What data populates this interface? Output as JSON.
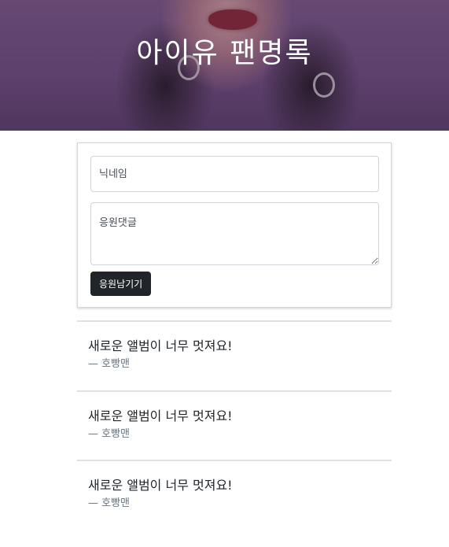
{
  "header": {
    "title": "아이유 팬명록"
  },
  "form": {
    "nickname_placeholder": "닉네임",
    "comment_placeholder": "응원댓글",
    "submit_label": "응원남기기"
  },
  "comments": [
    {
      "text": "새로운 앨범이 너무 멋져요!",
      "author": "— 호빵맨"
    },
    {
      "text": "새로운 앨범이 너무 멋져요!",
      "author": "— 호빵맨"
    },
    {
      "text": "새로운 앨범이 너무 멋져요!",
      "author": "— 호빵맨"
    }
  ]
}
